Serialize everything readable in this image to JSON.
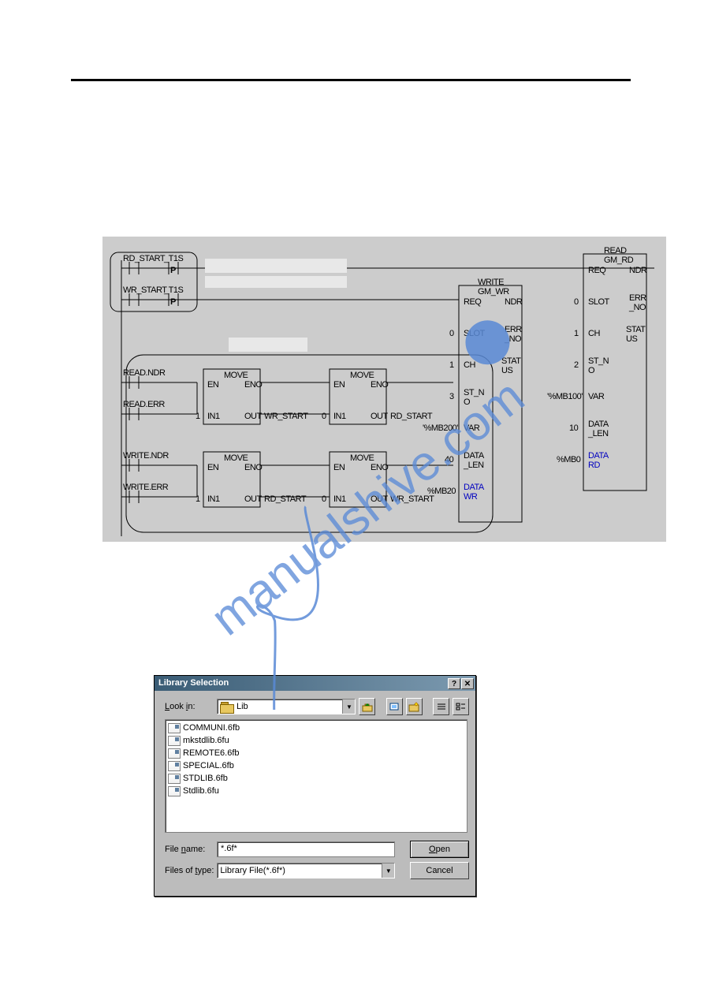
{
  "ladder": {
    "contacts": {
      "rd_start": "RD_START",
      "wr_start": "WR_START",
      "t1s_a": "_T1S",
      "t1s_b": "_T1S",
      "read_ndr": "READ.NDR",
      "read_err": "READ.ERR",
      "write_ndr": "WRITE.NDR",
      "write_err": "WRITE.ERR"
    },
    "pulse": "P",
    "blocks": {
      "move": "MOVE",
      "en": "EN",
      "eno": "ENO",
      "in1": "IN1",
      "out": "OUT"
    },
    "gm_wr": {
      "title1": "WRITE",
      "title2": "GM_WR",
      "rows": [
        [
          "",
          "REQ",
          "NDR",
          ""
        ],
        [
          "0",
          "SLOT",
          "ERR\n_NO",
          ""
        ],
        [
          "1",
          "CH",
          "STAT\nUS",
          ""
        ],
        [
          "3",
          "ST_N\nO",
          "",
          ""
        ],
        [
          "'%MB200'",
          "VAR",
          "",
          ""
        ],
        [
          "40",
          "DATA\n_LEN",
          "",
          ""
        ],
        [
          "%MB20",
          "DATA\nWR",
          "",
          ""
        ]
      ]
    },
    "gm_rd": {
      "title1": "READ",
      "title2": "GM_RD",
      "rows": [
        [
          "",
          "REQ",
          "NDR",
          ""
        ],
        [
          "0",
          "SLOT",
          "ERR\n_NO",
          ""
        ],
        [
          "1",
          "CH",
          "STAT\nUS",
          ""
        ],
        [
          "2",
          "ST_N\nO",
          "",
          ""
        ],
        [
          "'%MB100'",
          "VAR",
          "",
          ""
        ],
        [
          "10",
          "DATA\n_LEN",
          "",
          ""
        ],
        [
          "%MB0",
          "DATA\nRD",
          "",
          ""
        ]
      ]
    },
    "mid_vals": {
      "one_a": "1",
      "one_b": "1",
      "wr_start_out": "WR_START",
      "rd_start_out": "RD_START",
      "zero_a": "0",
      "zero_b": "0",
      "rd_start_out2": "RD_START",
      "wr_start_out2": "WR_START"
    }
  },
  "dialog": {
    "title": "Library Selection",
    "look_in_label": "Look in:",
    "look_in_value": "Lib",
    "files": [
      "COMMUNI.6fb",
      "mkstdlib.6fu",
      "REMOTE6.6fb",
      "SPECIAL.6fb",
      "STDLIB.6fb",
      "Stdlib.6fu"
    ],
    "file_name_label": "File name:",
    "file_name_value": "*.6f*",
    "files_type_label": "Files of type:",
    "files_type_value": "Library File(*.6f*)",
    "open": "Open",
    "cancel": "Cancel"
  }
}
